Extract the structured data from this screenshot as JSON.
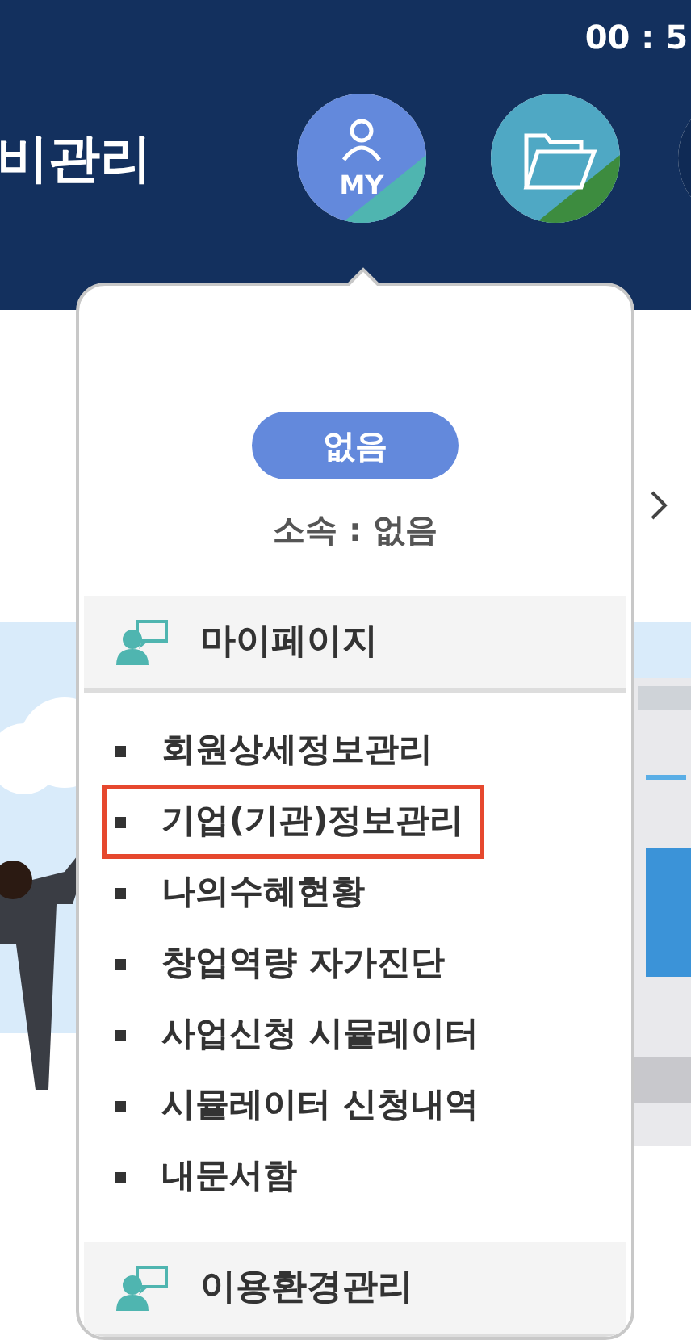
{
  "header": {
    "timer": "00 : 5",
    "title": "비관리",
    "icons": [
      {
        "kind": "my",
        "label": "MY"
      },
      {
        "kind": "folder"
      },
      {
        "kind": "partial"
      }
    ]
  },
  "dropdown": {
    "badge": "없음",
    "affiliation": "소속 : 없음",
    "sections": [
      {
        "title": "마이페이지",
        "items": [
          {
            "label": "회원상세정보관리",
            "selected": false
          },
          {
            "label": "기업(기관)정보관리",
            "selected": true
          },
          {
            "label": "나의수혜현황",
            "selected": false
          },
          {
            "label": "창업역량 자가진단",
            "selected": false
          },
          {
            "label": "사업신청 시뮬레이터",
            "selected": false
          },
          {
            "label": "시뮬레이터 신청내역",
            "selected": false
          },
          {
            "label": "내문서함",
            "selected": false
          }
        ]
      },
      {
        "title": "이용환경관리"
      }
    ]
  }
}
